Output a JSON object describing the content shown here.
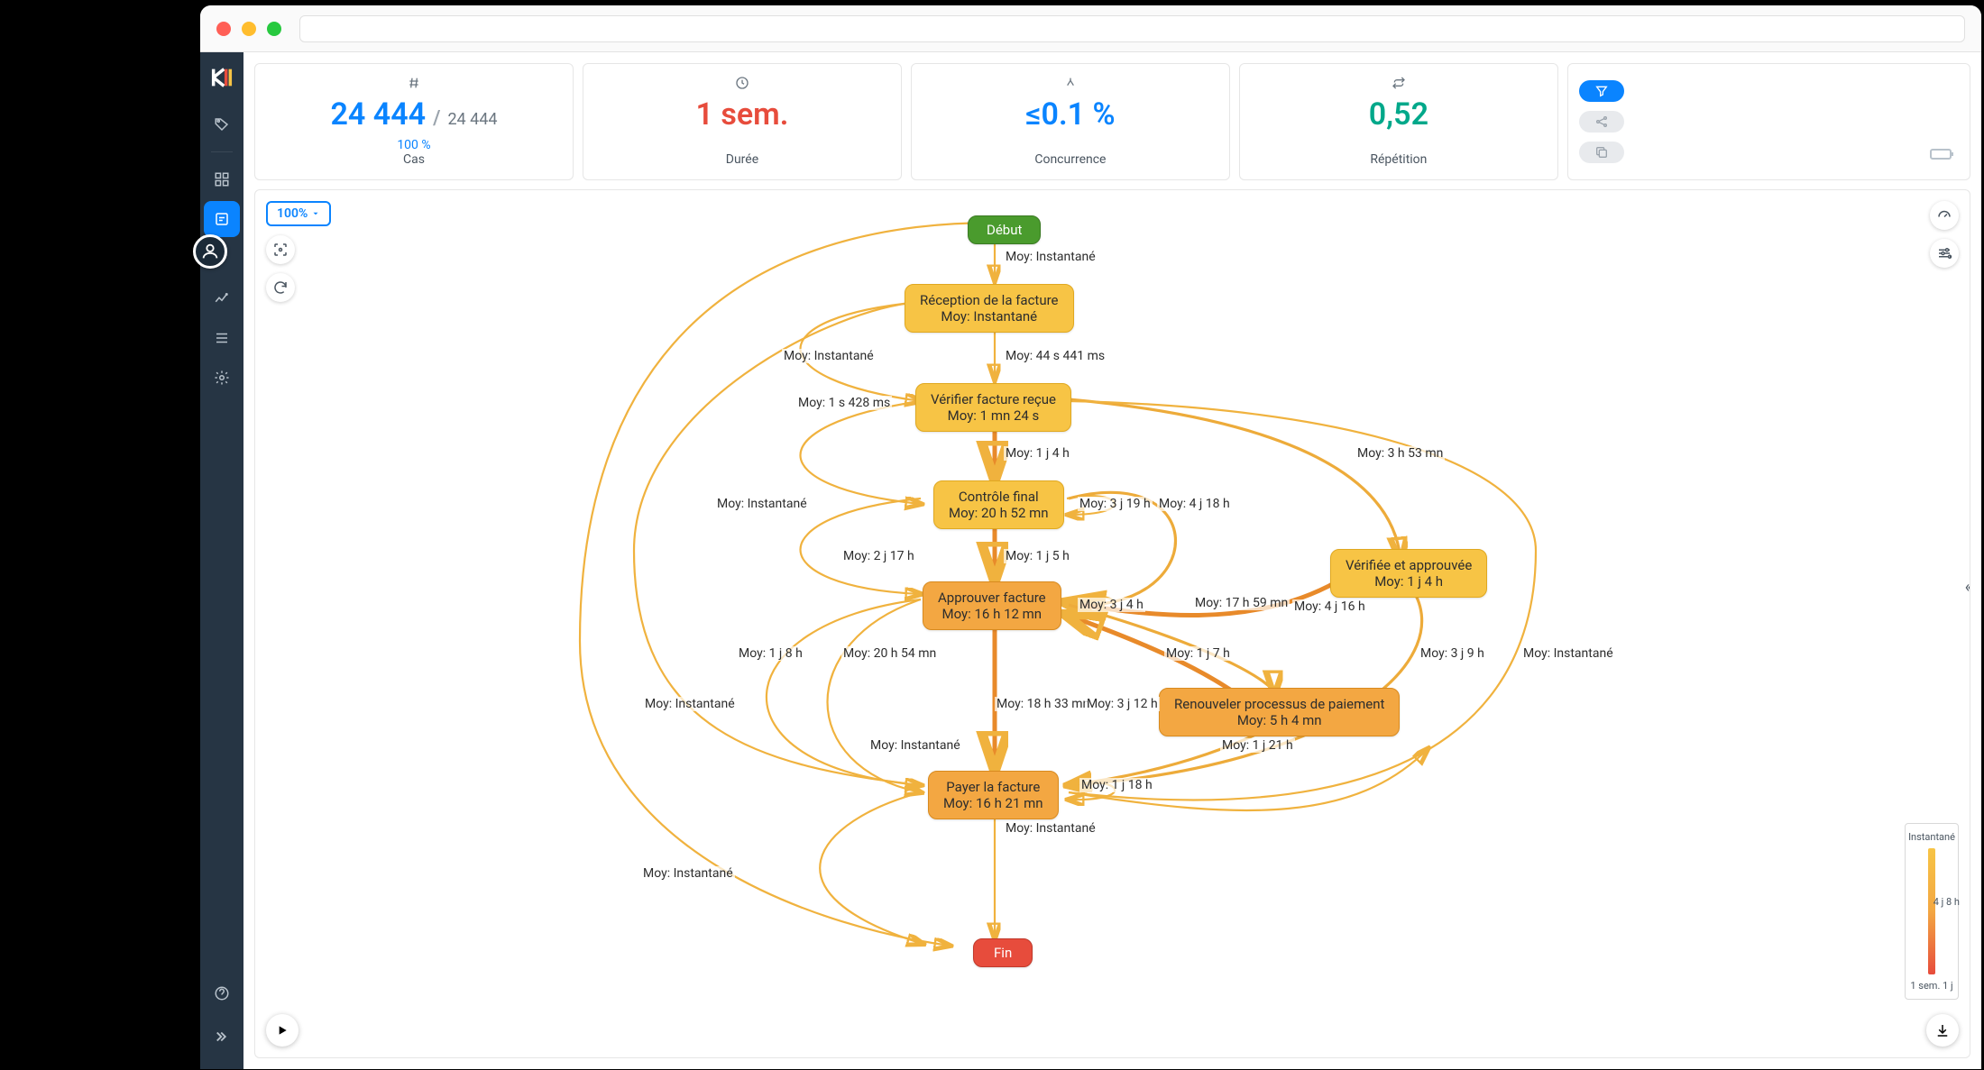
{
  "metrics": {
    "cases": {
      "value": "24 444",
      "total": "24 444",
      "percent": "100 %",
      "label": "Cas"
    },
    "duration": {
      "value": "1 sem.",
      "label": "Durée"
    },
    "concurrency": {
      "value": "≤0.1 %",
      "label": "Concurrence"
    },
    "repetition": {
      "value": "0,52",
      "label": "Répétition"
    }
  },
  "zoom": "100%",
  "legend": {
    "top": "Instantané",
    "mid": "4 j 8 h",
    "bottom": "1 sem. 1 j"
  },
  "nodes": {
    "start": "Début",
    "reception": {
      "l1": "Réception de la facture",
      "l2": "Moy: Instantané"
    },
    "verifier": {
      "l1": "Vérifier facture reçue",
      "l2": "Moy: 1 mn 24 s"
    },
    "controle": {
      "l1": "Contrôle final",
      "l2": "Moy: 20 h 52 mn"
    },
    "approuver": {
      "l1": "Approuver facture",
      "l2": "Moy: 16 h 12 mn"
    },
    "verifiee": {
      "l1": "Vérifiée et approuvée",
      "l2": "Moy: 1 j 4 h"
    },
    "renouveler": {
      "l1": "Renouveler processus de paiement",
      "l2": "Moy: 5 h 4 mn"
    },
    "payer": {
      "l1": "Payer la facture",
      "l2": "Moy: 16 h 21 mn"
    },
    "end": "Fin"
  },
  "edgeLabels": {
    "e1": "Moy: Instantané",
    "e2": "Moy: 44 s 441 ms",
    "e3": "Moy: Instantané",
    "e4": "Moy: 1 s 428 ms",
    "e5": "Moy: 1 j 4 h",
    "e6": "Moy: 3 h 53 mn",
    "e7": "Moy: Instantané",
    "e8": "Moy: 3 j 19 h",
    "e9": "Moy: 4 j 18 h",
    "e10": "Moy: 2 j 17 h",
    "e11": "Moy: 1 j 5 h",
    "e12": "Moy: 4 j 16 h",
    "e13": "Moy: 3 j 4 h",
    "e14": "Moy: 17 h 59 mn",
    "e15": "Moy: 1 j 8 h",
    "e16": "Moy: 20 h 54 mn",
    "e17": "Moy: 1 j 7 h",
    "e18": "Moy: 3 j 9 h",
    "e19": "Moy: Instantané",
    "e20": "Moy: 18 h 33 mn",
    "e21": "Moy: 3 j 12 h",
    "e22": "Moy: Instantané",
    "e23": "Moy: 1 j 21 h",
    "e24": "Moy: Instantané",
    "e25": "Moy: 1 j 18 h",
    "e26": "Moy: Instantané",
    "e27": "Moy: Instantané"
  }
}
